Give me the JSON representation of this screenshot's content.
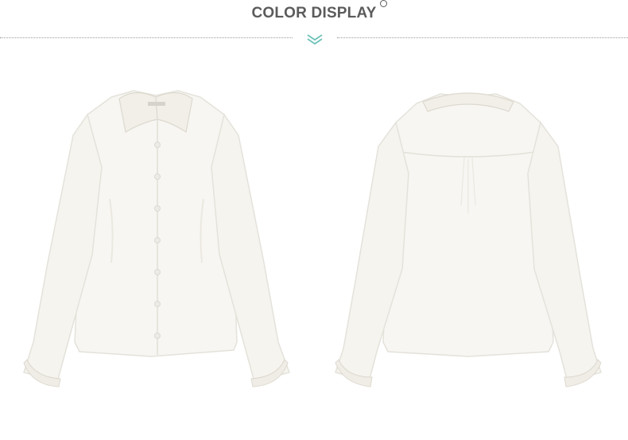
{
  "header": {
    "title": "COLOR DISPLAY"
  },
  "colors": {
    "title": "#5b5b5b",
    "chevron": "#6ec3b9",
    "shirt": "#f7f6f2",
    "shirt_shadow": "#e6e4dd",
    "divider": "#9a9a9a"
  },
  "products": [
    {
      "view": "front"
    },
    {
      "view": "back"
    }
  ]
}
